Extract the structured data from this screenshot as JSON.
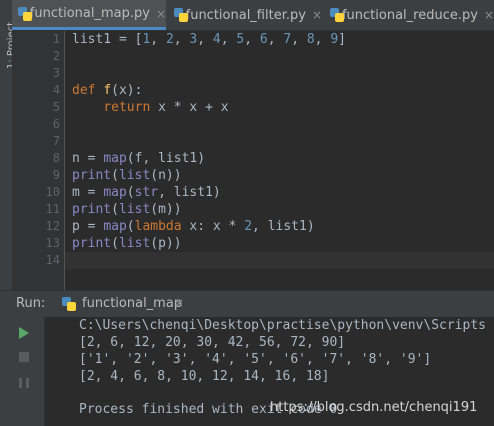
{
  "sidebar": {
    "project_label": "1: Project"
  },
  "tabs": [
    {
      "label": "functional_map.py",
      "close": "×"
    },
    {
      "label": "functional_filter.py",
      "close": "×"
    },
    {
      "label": "functional_reduce.py",
      "close": "×"
    }
  ],
  "editor": {
    "line_numbers": [
      "1",
      "2",
      "3",
      "4",
      "5",
      "6",
      "7",
      "8",
      "9",
      "10",
      "11",
      "12",
      "13",
      "14"
    ],
    "lines": [
      "list1 = [1, 2, 3, 4, 5, 6, 7, 8, 9]",
      "",
      "",
      "def f(x):",
      "    return x * x + x",
      "",
      "",
      "n = map(f, list1)",
      "print(list(n))",
      "m = map(str, list1)",
      "print(list(m))",
      "p = map(lambda x: x * 2, list1)",
      "print(list(p))",
      ""
    ]
  },
  "run_panel": {
    "label": "Run:",
    "tab_name": "functional_map",
    "tab_close": "×",
    "output": [
      "C:\\Users\\chenqi\\Desktop\\practise\\python\\venv\\Scripts",
      "[2, 6, 12, 20, 30, 42, 56, 72, 90]",
      "['1', '2', '3', '4', '5', '6', '7', '8', '9']",
      "[2, 4, 6, 8, 10, 12, 14, 16, 18]",
      "",
      "Process finished with exit code 0"
    ]
  },
  "watermark": "https://blog.csdn.net/chenqi191",
  "colors": {
    "accent": "#4a88c7",
    "keyword": "#cc7832",
    "number": "#6897bb",
    "builtin": "#8888c6",
    "function": "#ffc66d"
  }
}
